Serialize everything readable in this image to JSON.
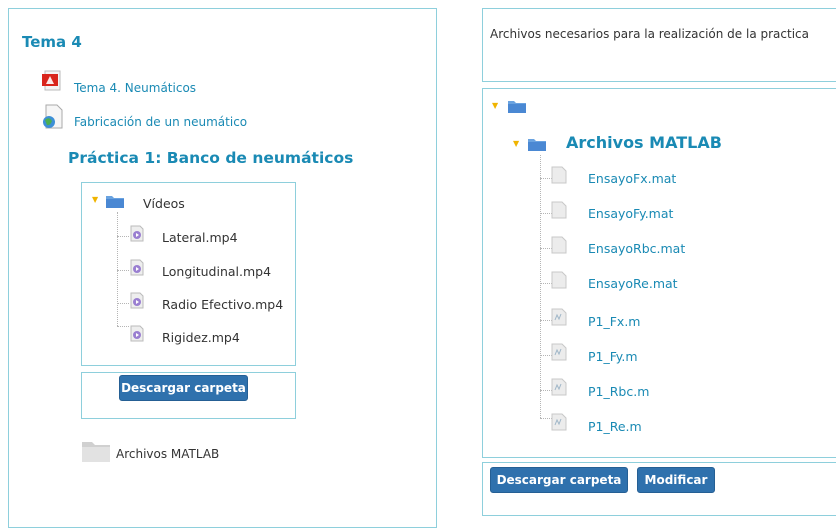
{
  "left": {
    "title": "Tema 4",
    "resources": [
      {
        "label": "Tema 4. Neumáticos",
        "icon": "pdf-icon"
      },
      {
        "label": "Fabricación de un neumático",
        "icon": "web-link-icon"
      }
    ],
    "practice_title": "Práctica 1: Banco de neumáticos",
    "tree": {
      "folder": "Vídeos",
      "files": [
        "Lateral.mp4",
        "Longitudinal.mp4",
        "Radio Efectivo.mp4",
        "Rigidez.mp4"
      ]
    },
    "download_label": "Descargar carpeta",
    "bottom_folder": "Archivos MATLAB"
  },
  "right": {
    "description": "Archivos necesarios para la realización de la practica",
    "tree": {
      "root_label": "",
      "folder": "Archivos MATLAB",
      "files": [
        "EnsayoFx.mat",
        "EnsayoFy.mat",
        "EnsayoRbc.mat",
        "EnsayoRe.mat",
        "P1_Fx.m",
        "P1_Fy.m",
        "P1_Rbc.m",
        "P1_Re.m"
      ]
    },
    "download_label": "Descargar carpeta",
    "modify_label": "Modificar"
  },
  "colors": {
    "accent": "#1a8ab4",
    "button": "#2f71ad",
    "border": "#8ecfdc"
  }
}
